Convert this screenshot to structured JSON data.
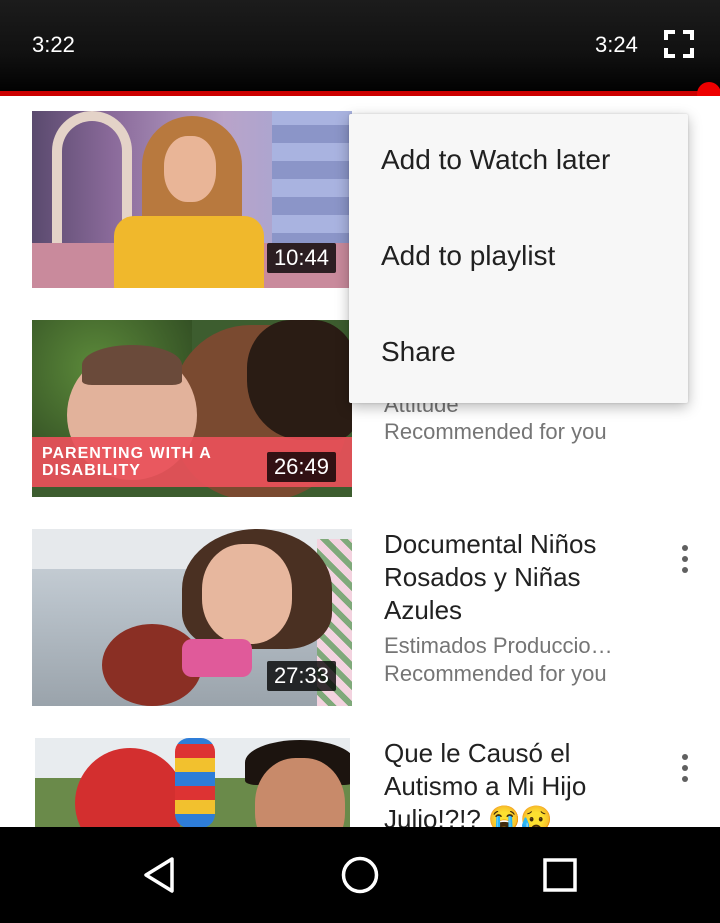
{
  "player": {
    "current_time": "3:22",
    "duration": "3:24",
    "progress_fraction": 0.99,
    "accent_color": "#ee0000",
    "fullscreen_icon": "fullscreen-icon"
  },
  "videos": [
    {
      "duration": "10:44",
      "title": "",
      "channel": "",
      "note": ""
    },
    {
      "duration": "26:49",
      "thumbnail_banner": "PARENTING WITH A DISABILITY",
      "title_partial": "Attitude",
      "note": "Recommended for you"
    },
    {
      "duration": "27:33",
      "title": "Documental Niños Rosados y Niñas Azules",
      "channel": "Estimados Produccio…",
      "note": "Recommended for you",
      "menu_icon": "more-vert-icon"
    },
    {
      "title": "Que le Causó el Autismo a Mi Hijo Julio!?!? 😭😥",
      "menu_icon": "more-vert-icon"
    }
  ],
  "menu": {
    "items": [
      "Add to Watch later",
      "Add to playlist",
      "Share"
    ]
  },
  "navbar": {
    "back_icon": "back-triangle-icon",
    "home_icon": "home-circle-icon",
    "recents_icon": "recents-square-icon"
  }
}
